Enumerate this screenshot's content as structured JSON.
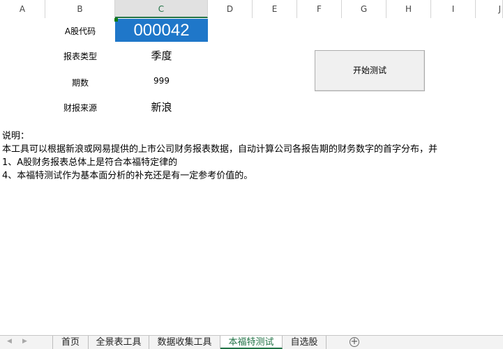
{
  "columns": [
    "A",
    "B",
    "C",
    "D",
    "E",
    "F",
    "G",
    "H",
    "I",
    "J"
  ],
  "fields": {
    "code_label": "A股代码",
    "code_value": "000042",
    "type_label": "报表类型",
    "type_value": "季度",
    "period_label": "期数",
    "period_value": "999",
    "source_label": "财报来源",
    "source_value": "新浪"
  },
  "start_button_label": "开始测试",
  "notes": [
    "说明：",
    "本工具可以根据新浪或网易提供的上市公司财务报表数据，自动计算公司各报告期的财务数字的首字分布，并",
    "1、A股财务报表总体上是符合本福特定律的",
    "4、本福特测试作为基本面分析的补充还是有一定参考价值的。"
  ],
  "sheet_tabs": [
    "首页",
    "全景表工具",
    "数据收集工具",
    "本福特测试",
    "自选股"
  ],
  "active_tab": "本福特测试",
  "colors": {
    "selected_cell": "#1f77c9",
    "accent_green": "#217346"
  }
}
